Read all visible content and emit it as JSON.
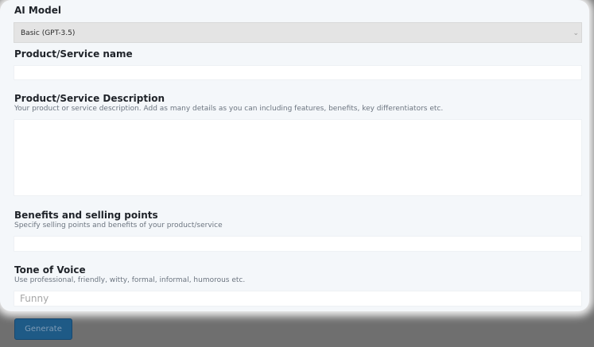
{
  "ai_model": {
    "label": "AI Model",
    "selected": "Basic (GPT-3.5)"
  },
  "product_name": {
    "label": "Product/Service name",
    "value": ""
  },
  "product_description": {
    "label": "Product/Service Description",
    "hint": "Your product or service description. Add as many details as you can including features, benefits, key differentiators etc.",
    "value": ""
  },
  "benefits": {
    "label": "Benefits and selling points",
    "hint": "Specify selling points and benefits of your product/service",
    "value": ""
  },
  "tone": {
    "label": "Tone of Voice",
    "hint": "Use professional, friendly, witty, formal, informal, humorous etc.",
    "placeholder": "Funny"
  },
  "actions": {
    "generate_label": "Generate"
  },
  "colors": {
    "panel": "#f4f7fa",
    "backdrop": "#6f6f6f",
    "button": "#1e5a86"
  }
}
